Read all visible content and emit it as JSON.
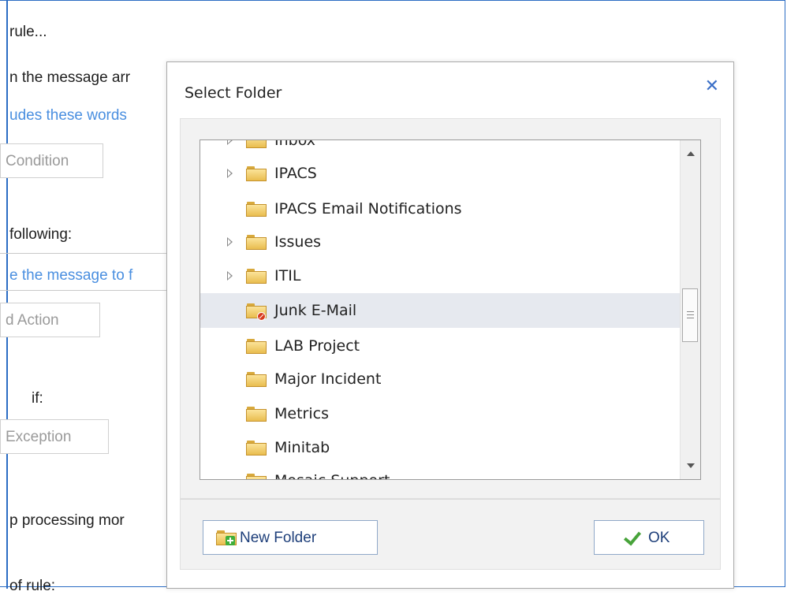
{
  "background": {
    "rule_title": "rule...",
    "when_arrives": "n the message arr",
    "condition_link": "udes these words",
    "add_condition": "Condition",
    "do_following": "following:",
    "action_link": "e the message to f",
    "add_action": "d Action",
    "except_if": "if:",
    "add_exception": "Exception",
    "stop_processing": "p processing mor",
    "rule_name": "of rule:"
  },
  "dialog": {
    "title": "Select Folder",
    "close_glyph": "✕",
    "folders": [
      {
        "label": "Inbox",
        "expander": true
      },
      {
        "label": "IPACS",
        "expander": true
      },
      {
        "label": "IPACS Email Notifications",
        "expander": false
      },
      {
        "label": "Issues",
        "expander": true
      },
      {
        "label": "ITIL",
        "expander": true
      },
      {
        "label": "Junk E-Mail",
        "expander": false,
        "selected": true,
        "icon": "junk-folder-icon"
      },
      {
        "label": "LAB Project",
        "expander": false
      },
      {
        "label": "Major Incident",
        "expander": false
      },
      {
        "label": "Metrics",
        "expander": false
      },
      {
        "label": "Minitab",
        "expander": false
      },
      {
        "label": "Mosaic Support",
        "expander": false
      }
    ],
    "new_folder_label": "New Folder",
    "ok_label": "OK"
  },
  "colors": {
    "accent": "#2b6cc4",
    "link": "#4a8fe0",
    "selected_row": "#e6e9ef",
    "folder": "#e9bd4f",
    "ok_check": "#47a33a"
  }
}
